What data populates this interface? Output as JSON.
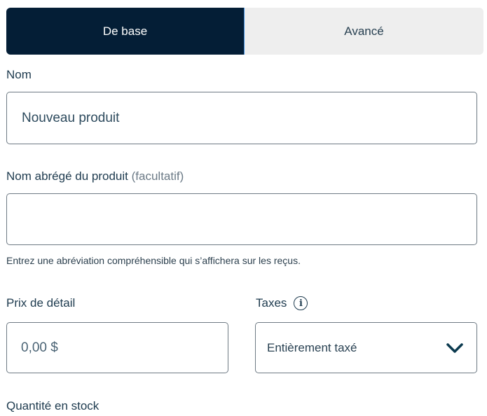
{
  "tabs": [
    {
      "label": "De base",
      "active": true
    },
    {
      "label": "Avancé",
      "active": false
    }
  ],
  "name": {
    "label": "Nom",
    "value": "Nouveau produit"
  },
  "short_name": {
    "label": "Nom abrégé du produit",
    "optional": "(facultatif)",
    "value": "",
    "helper": "Entrez une abréviation compréhensible qui s’affichera sur les reçus."
  },
  "price": {
    "label": "Prix de détail",
    "placeholder": "0,00 $"
  },
  "taxes": {
    "label": "Taxes",
    "icon": "info-icon",
    "selected": "Entièrement taxé"
  },
  "stock": {
    "label": "Quantité en stock"
  },
  "colors": {
    "tab_active_bg": "#041e36",
    "tab_inactive_bg": "#eeeeee",
    "text": "#1d3a4e"
  }
}
